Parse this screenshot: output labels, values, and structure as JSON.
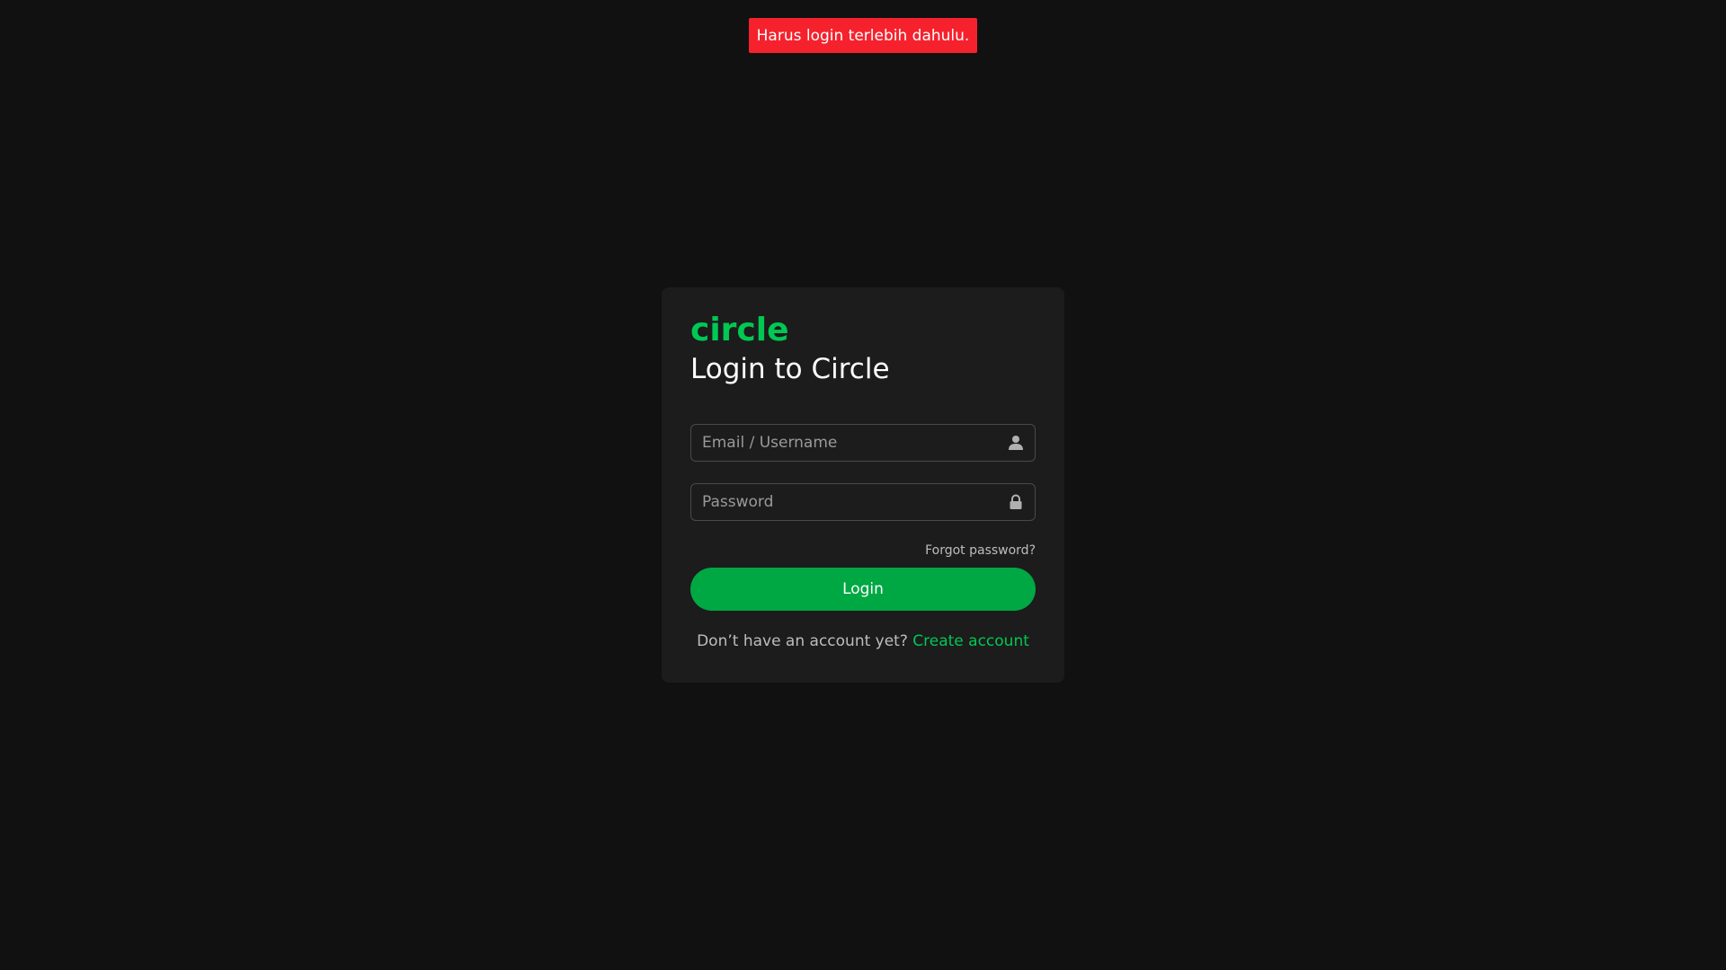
{
  "toast": {
    "message": "Harus login terlebih dahulu.",
    "color": "#f5222d"
  },
  "card": {
    "brand": "circle",
    "title": "Login to Circle",
    "email_placeholder": "Email / Username",
    "email_icon": "user-icon",
    "password_placeholder": "Password",
    "password_icon": "lock-icon",
    "forgot_password": "Forgot password?",
    "login_label": "Login",
    "signup_prompt": "Don’t have an account yet?",
    "signup_link": "Create account"
  },
  "colors": {
    "background": "#111111",
    "card": "#1c1c1c",
    "accent": "#00c853",
    "button": "#00a843"
  }
}
